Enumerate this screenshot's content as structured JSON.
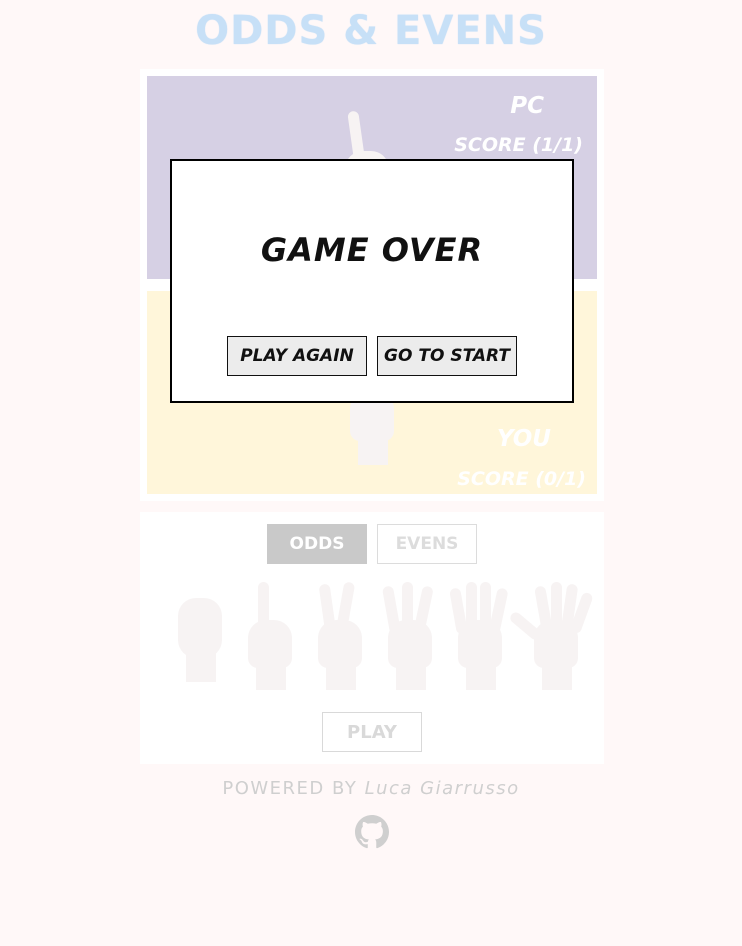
{
  "app": {
    "title": "ODDS & EVENS"
  },
  "pc_panel": {
    "name": "PC",
    "score": "SCORE (1/1)",
    "background_color": "#d6d0e4"
  },
  "you_panel": {
    "name": "YOU",
    "score": "SCORE (0/1)",
    "background_color": "#fff6da"
  },
  "controls": {
    "odds_label": "ODDS",
    "evens_label": "EVENS",
    "selected": "ODDS",
    "finger_choices": [
      0,
      1,
      2,
      3,
      4,
      5
    ],
    "play_label": "PLAY"
  },
  "footer": {
    "powered_by": "POWERED BY",
    "author": "Luca Giarrusso",
    "github_icon": "github-icon"
  },
  "modal": {
    "title": "GAME OVER",
    "play_again_label": "PLAY AGAIN",
    "go_to_start_label": "GO TO START"
  },
  "colors": {
    "title": "#c7e0f7",
    "page_background": "#fff8f8",
    "modal_border": "#000000"
  }
}
